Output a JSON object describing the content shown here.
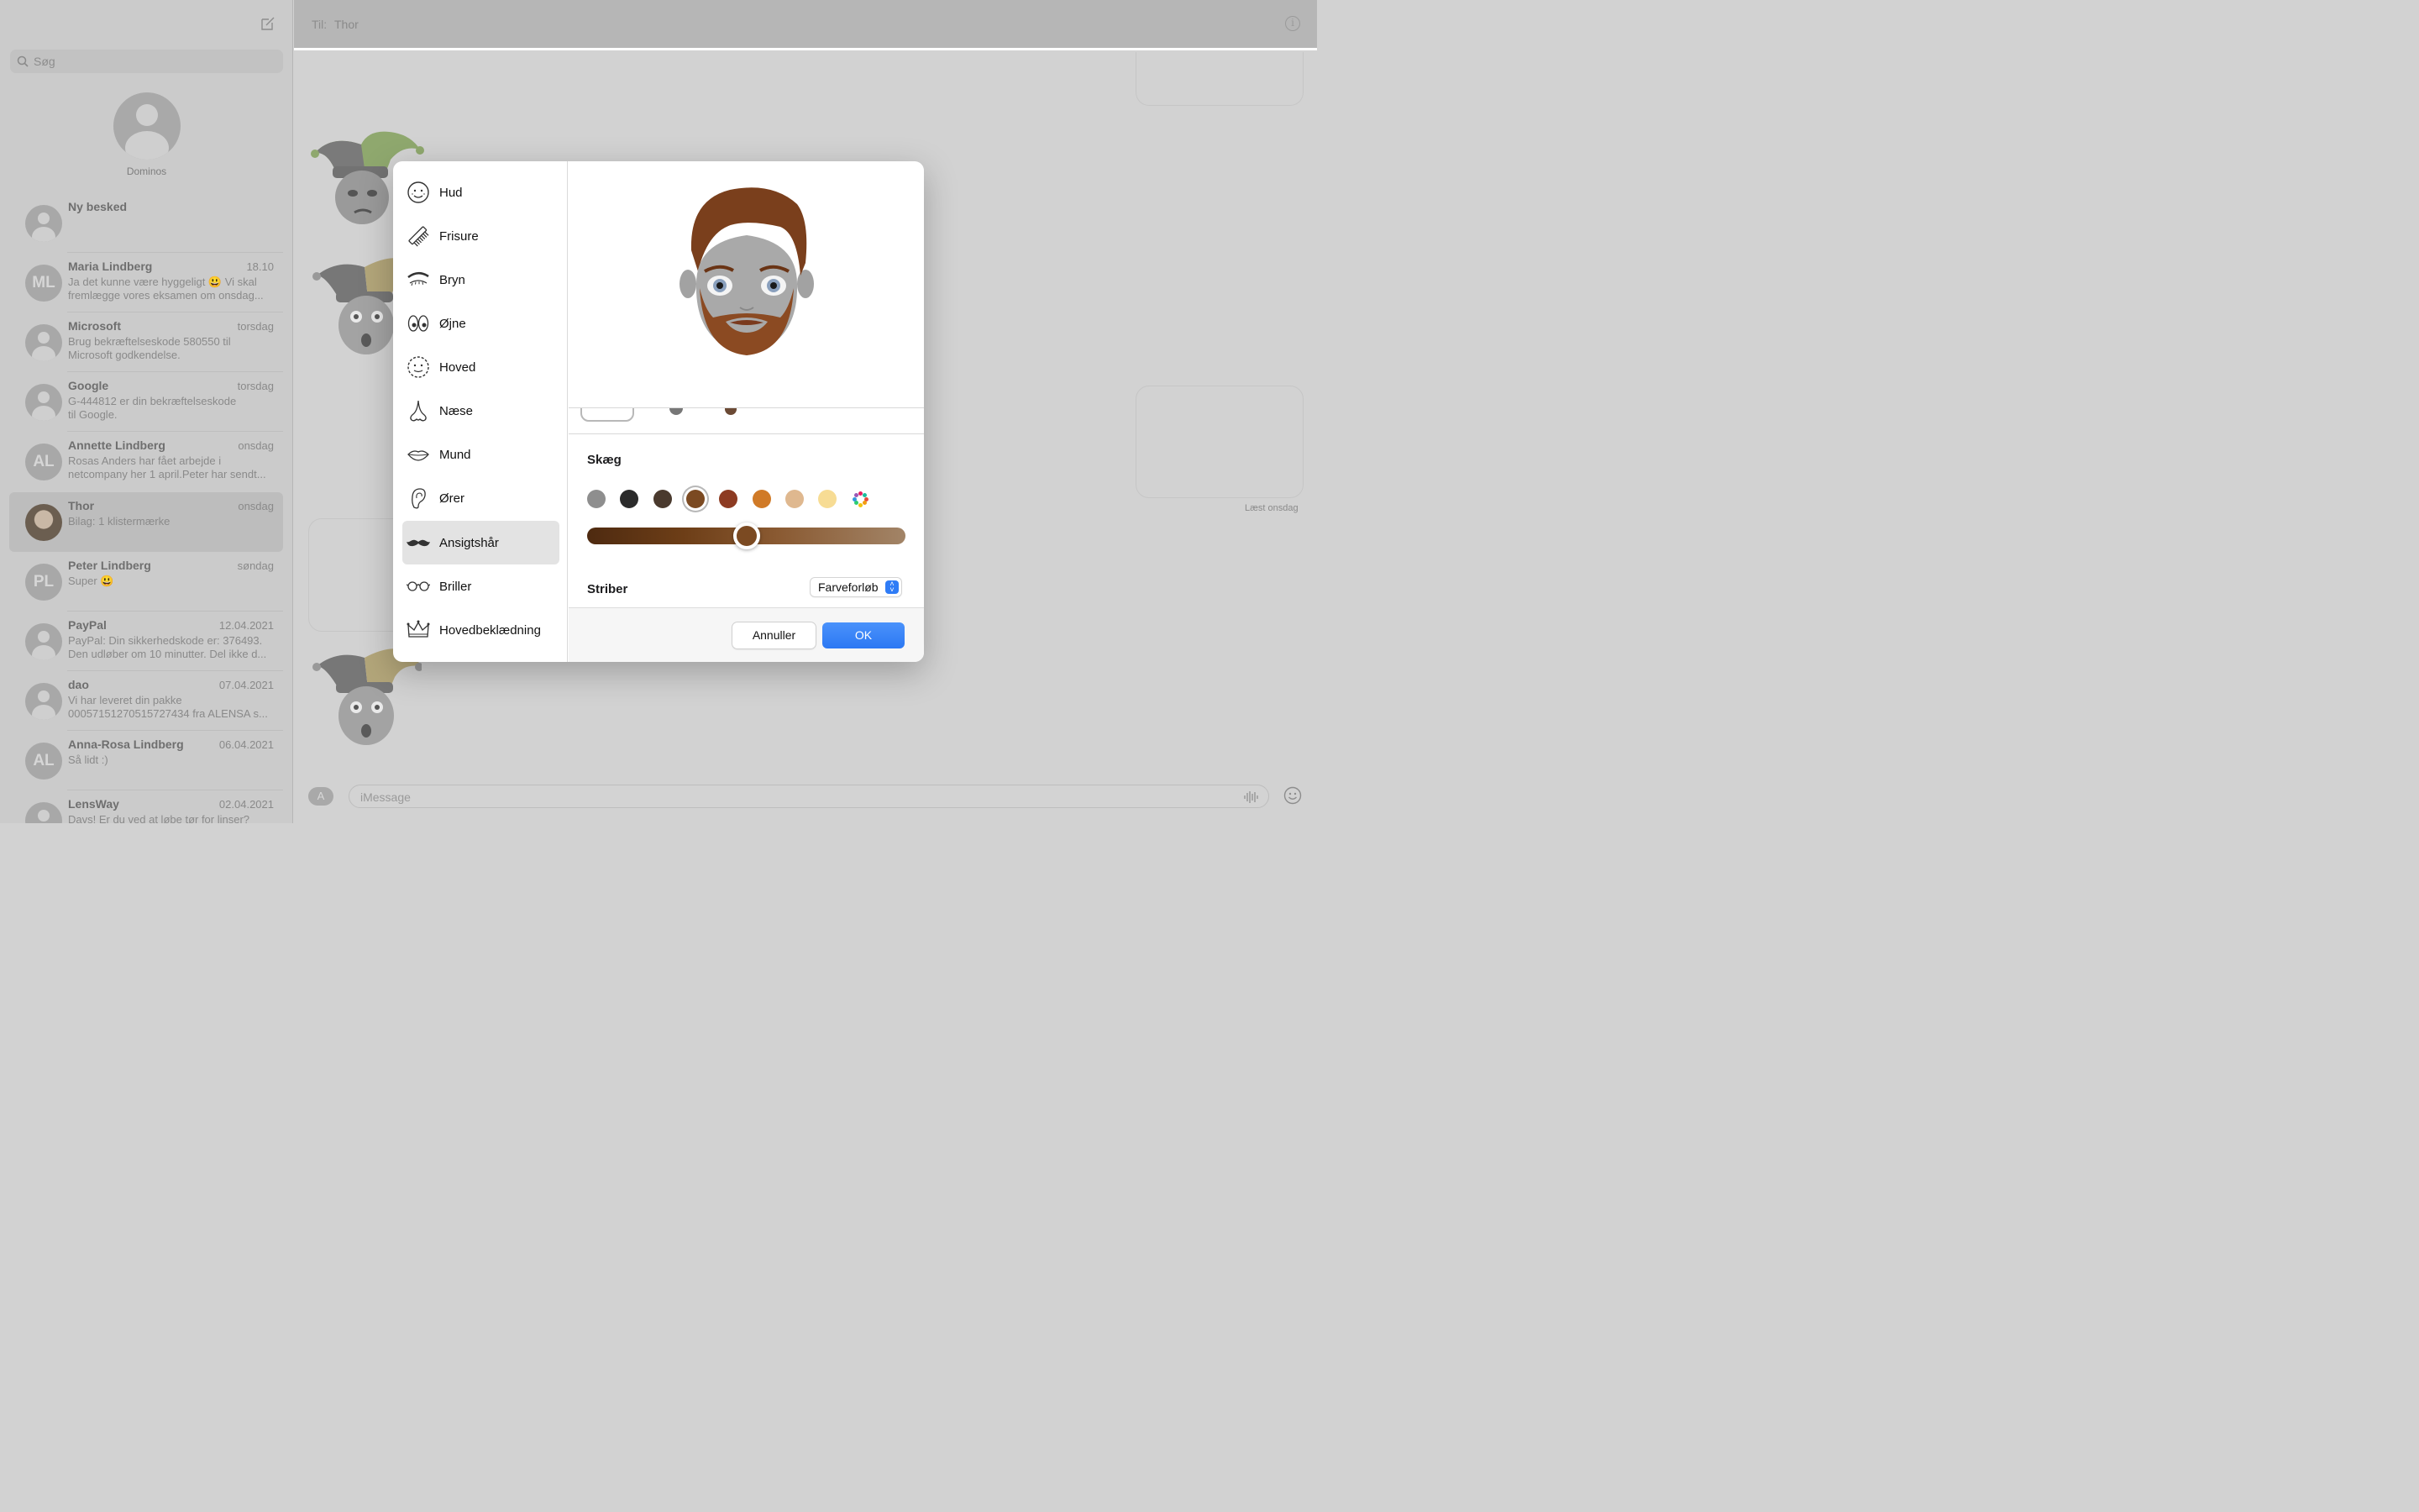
{
  "sidebar": {
    "search_placeholder": "Søg",
    "pinned_name": "Dominos",
    "conversations": [
      {
        "name": "Ny besked",
        "time": "",
        "preview": "",
        "initials": ""
      },
      {
        "name": "Maria Lindberg",
        "time": "18.10",
        "preview": "Ja det kunne være hyggeligt 😃 Vi skal fremlægge vores eksamen om onsdag...",
        "initials": "ML"
      },
      {
        "name": "Microsoft",
        "time": "torsdag",
        "preview": "Brug bekræftelseskode 580550 til\nMicrosoft godkendelse.",
        "initials": ""
      },
      {
        "name": "Google",
        "time": "torsdag",
        "preview": "G-444812 er din bekræftelseskode\ntil Google.",
        "initials": ""
      },
      {
        "name": "Annette Lindberg",
        "time": "onsdag",
        "preview": "Rosas Anders har fået arbejde i netcompany her 1 april.Peter har sendt...",
        "initials": "AL"
      },
      {
        "name": "Thor",
        "time": "onsdag",
        "preview": "Bilag: 1 klistermærke",
        "initials": ""
      },
      {
        "name": "Peter Lindberg",
        "time": "søndag",
        "preview": "Super 😃",
        "initials": "PL"
      },
      {
        "name": "PayPal",
        "time": "12.04.2021",
        "preview": "PayPal: Din sikkerhedskode er: 376493. Den udløber om 10 minutter. Del ikke d...",
        "initials": ""
      },
      {
        "name": "dao",
        "time": "07.04.2021",
        "preview": "Vi har leveret din pakke\n00057151270515727434 fra ALENSA s...",
        "initials": ""
      },
      {
        "name": "Anna-Rosa Lindberg",
        "time": "06.04.2021",
        "preview": "Så lidt :)",
        "initials": "AL"
      },
      {
        "name": "LensWay",
        "time": "02.04.2021",
        "preview": "Davs! Er du ved at løbe tør for linser?",
        "initials": ""
      }
    ]
  },
  "header": {
    "to_label": "Til:",
    "recipient": "Thor"
  },
  "thread": {
    "read_receipt": "Læst onsdag"
  },
  "input": {
    "placeholder": "iMessage"
  },
  "modal": {
    "categories": [
      {
        "label": "Hud",
        "icon": "face-skin-icon"
      },
      {
        "label": "Frisure",
        "icon": "comb-icon"
      },
      {
        "label": "Bryn",
        "icon": "eyebrow-icon"
      },
      {
        "label": "Øjne",
        "icon": "eyes-icon"
      },
      {
        "label": "Hoved",
        "icon": "head-outline-icon"
      },
      {
        "label": "Næse",
        "icon": "nose-icon"
      },
      {
        "label": "Mund",
        "icon": "mouth-icon"
      },
      {
        "label": "Ører",
        "icon": "ear-icon"
      },
      {
        "label": "Ansigtshår",
        "icon": "mustache-icon"
      },
      {
        "label": "Briller",
        "icon": "glasses-icon"
      },
      {
        "label": "Hovedbeklædning",
        "icon": "crown-icon"
      }
    ],
    "selected_category": "Ansigtshår",
    "section_title": "Skæg",
    "beard_colors": [
      "#8e8e8e",
      "#2b2b2b",
      "#4a3a2e",
      "#7b4a22",
      "#8d3b22",
      "#d07a27",
      "#dfb88f",
      "#f7dc94",
      "multicolor"
    ],
    "selected_color": "#7b4a22",
    "shade_level": 0.5,
    "stripes_label": "Striber",
    "stripes_value": "Farveforløb",
    "cancel_label": "Annuller",
    "ok_label": "OK"
  }
}
